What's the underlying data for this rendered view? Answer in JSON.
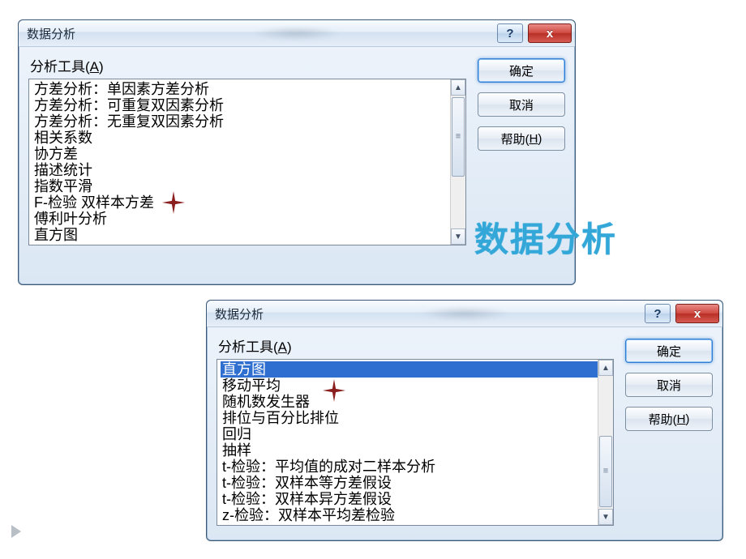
{
  "slide": {
    "big_label": "数据分析"
  },
  "dialog1": {
    "title": "数据分析",
    "section_label_pre": "分析工具(",
    "section_accel": "A",
    "section_label_post": ")",
    "items": [
      "方差分析：单因素方差分析",
      "方差分析：可重复双因素分析",
      "方差分析：无重复双因素分析",
      "相关系数",
      "协方差",
      "描述统计",
      "指数平滑",
      "F-检验 双样本方差",
      "傅利叶分析",
      "直方图"
    ],
    "buttons": {
      "ok": "确定",
      "cancel": "取消",
      "help_pre": "帮助(",
      "help_accel": "H",
      "help_post": ")"
    },
    "winbtns": {
      "help": "?",
      "close": "x"
    }
  },
  "dialog2": {
    "title": "数据分析",
    "section_label_pre": "分析工具(",
    "section_accel": "A",
    "section_label_post": ")",
    "items": [
      "直方图",
      "移动平均",
      "随机数发生器",
      "排位与百分比排位",
      "回归",
      "抽样",
      "t-检验：平均值的成对二样本分析",
      "t-检验：双样本等方差假设",
      "t-检验：双样本异方差假设",
      "z-检验：双样本平均差检验"
    ],
    "selected_index": 0,
    "buttons": {
      "ok": "确定",
      "cancel": "取消",
      "help_pre": "帮助(",
      "help_accel": "H",
      "help_post": ")"
    },
    "winbtns": {
      "help": "?",
      "close": "x"
    }
  }
}
